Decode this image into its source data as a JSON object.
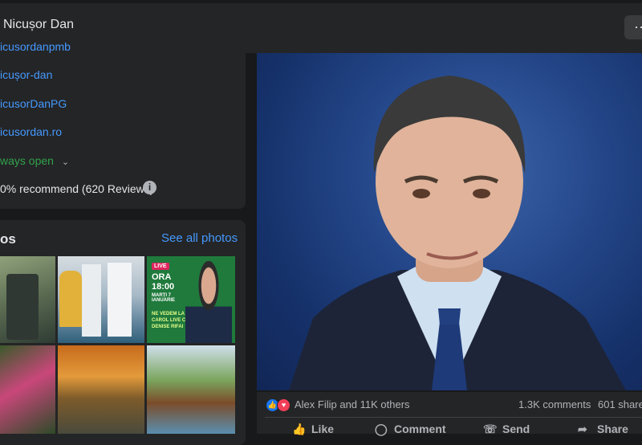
{
  "header": {
    "page_name": "Nicușor Dan",
    "more_label": "···"
  },
  "intro": {
    "links": [
      "icusordanpmb",
      "icușor-dan",
      "icusorDanPG",
      "icusordan.ro"
    ],
    "hours": "ways open",
    "recommend": "0% recommend (620 Reviews)"
  },
  "photos": {
    "title": "os",
    "see_all": "See all photos",
    "thumb3": {
      "live_badge": "LIVE",
      "time_text": "ORA 18:00",
      "date_text": "MARȚI 7 IANUARIE",
      "caption": "NE VEDEM LA CAROL LIVE CU DENISE RIFAI"
    }
  },
  "post": {
    "reactions_text": "Alex Filip and 11K others",
    "comments": "1.3K comments",
    "shares": "601 share",
    "actions": {
      "like": "Like",
      "comment": "Comment",
      "send": "Send",
      "share": "Share"
    }
  },
  "icons": [
    "chevron-down-icon",
    "info-icon",
    "like-reaction-icon",
    "love-reaction-icon",
    "thumbs-up-icon",
    "comment-icon",
    "messenger-icon",
    "share-icon"
  ],
  "colors": {
    "link": "#4599ff",
    "open": "#31a24c",
    "card": "#242526",
    "bg": "#18191a",
    "like": "#1877f2",
    "love": "#f33e58"
  }
}
